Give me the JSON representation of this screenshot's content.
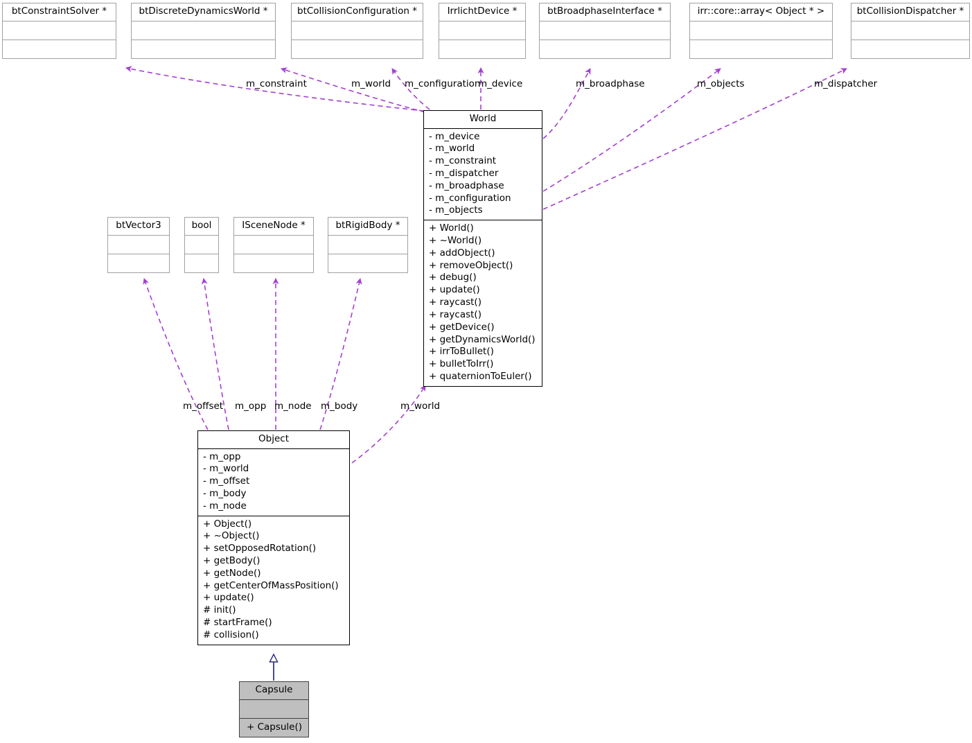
{
  "diagram": {
    "type": "uml-class-diagram",
    "title": "World collaboration diagram",
    "colors": {
      "association_edge": "#a33fd0",
      "inheritance_edge": "#2a2a80",
      "box_border_light": "#a0a0a0",
      "box_border_strong": "#000000",
      "box_fill_highlight": "#bfbfbf",
      "background": "#ffffff",
      "text": "#000000"
    }
  },
  "classes": {
    "bt_constraint_solver": {
      "name": "btConstraintSolver *",
      "attributes": [],
      "methods": []
    },
    "bt_discrete_dynamics_world": {
      "name": "btDiscreteDynamicsWorld *",
      "attributes": [],
      "methods": []
    },
    "bt_collision_configuration": {
      "name": "btCollisionConfiguration *",
      "attributes": [],
      "methods": []
    },
    "irrlicht_device": {
      "name": "IrrlichtDevice *",
      "attributes": [],
      "methods": []
    },
    "bt_broadphase_interface": {
      "name": "btBroadphaseInterface *",
      "attributes": [],
      "methods": []
    },
    "irr_core_array": {
      "name": "irr::core::array< Object * >",
      "attributes": [],
      "methods": []
    },
    "bt_collision_dispatcher": {
      "name": "btCollisionDispatcher *",
      "attributes": [],
      "methods": []
    },
    "bt_vector3": {
      "name": "btVector3",
      "attributes": [],
      "methods": []
    },
    "bool": {
      "name": "bool",
      "attributes": [],
      "methods": []
    },
    "iscene_node": {
      "name": "ISceneNode *",
      "attributes": [],
      "methods": []
    },
    "bt_rigid_body": {
      "name": "btRigidBody *",
      "attributes": [],
      "methods": []
    },
    "world": {
      "name": "World",
      "attributes": [
        "- m_device",
        "- m_world",
        "- m_constraint",
        "- m_dispatcher",
        "- m_broadphase",
        "- m_configuration",
        "- m_objects"
      ],
      "methods": [
        "+ World()",
        "+ ~World()",
        "+ addObject()",
        "+ removeObject()",
        "+ debug()",
        "+ update()",
        "+ raycast()",
        "+ raycast()",
        "+ getDevice()",
        "+ getDynamicsWorld()",
        "+ irrToBullet()",
        "+ bulletToIrr()",
        "+ quaternionToEuler()"
      ]
    },
    "object": {
      "name": "Object",
      "attributes": [
        "- m_opp",
        "- m_world",
        "- m_offset",
        "- m_body",
        "- m_node"
      ],
      "methods": [
        "+ Object()",
        "+ ~Object()",
        "+ setOpposedRotation()",
        "+ getBody()",
        "+ getNode()",
        "+ getCenterOfMassPosition()",
        "+ update()",
        "# init()",
        "# startFrame()",
        "# collision()"
      ]
    },
    "capsule": {
      "name": "Capsule",
      "attributes": [],
      "methods": [
        "+ Capsule()"
      ]
    }
  },
  "edge_labels": {
    "m_constraint": "m_constraint",
    "m_world_top": "m_world",
    "m_configuration": "m_configuration",
    "m_device": "m_device",
    "m_broadphase": "m_broadphase",
    "m_objects": "m_objects",
    "m_dispatcher": "m_dispatcher",
    "m_offset": "m_offset",
    "m_opp": "m_opp",
    "m_node": "m_node",
    "m_body": "m_body",
    "m_world_mid": "m_world"
  },
  "relationships": [
    {
      "from": "world",
      "to": "bt_constraint_solver",
      "label": "m_constraint",
      "kind": "association"
    },
    {
      "from": "world",
      "to": "bt_discrete_dynamics_world",
      "label": "m_world",
      "kind": "association"
    },
    {
      "from": "world",
      "to": "bt_collision_configuration",
      "label": "m_configuration",
      "kind": "association"
    },
    {
      "from": "world",
      "to": "irrlicht_device",
      "label": "m_device",
      "kind": "association"
    },
    {
      "from": "world",
      "to": "bt_broadphase_interface",
      "label": "m_broadphase",
      "kind": "association"
    },
    {
      "from": "world",
      "to": "irr_core_array",
      "label": "m_objects",
      "kind": "association"
    },
    {
      "from": "world",
      "to": "bt_collision_dispatcher",
      "label": "m_dispatcher",
      "kind": "association"
    },
    {
      "from": "object",
      "to": "bt_vector3",
      "label": "m_offset",
      "kind": "association"
    },
    {
      "from": "object",
      "to": "bool",
      "label": "m_opp",
      "kind": "association"
    },
    {
      "from": "object",
      "to": "iscene_node",
      "label": "m_node",
      "kind": "association"
    },
    {
      "from": "object",
      "to": "bt_rigid_body",
      "label": "m_body",
      "kind": "association"
    },
    {
      "from": "object",
      "to": "world",
      "label": "m_world",
      "kind": "association"
    },
    {
      "from": "capsule",
      "to": "object",
      "label": "",
      "kind": "inheritance"
    }
  ]
}
